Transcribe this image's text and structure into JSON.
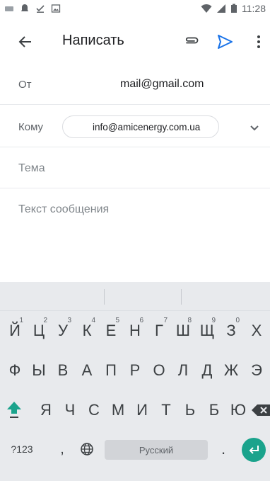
{
  "status_bar": {
    "time": "11:28"
  },
  "app_bar": {
    "title": "Написать"
  },
  "from": {
    "label": "От",
    "value": "mail@gmail.com"
  },
  "to": {
    "label": "Кому",
    "chip": "info@amicenergy.com.ua"
  },
  "subject": {
    "placeholder": "Тема"
  },
  "body": {
    "placeholder": "Текст сообщения"
  },
  "keyboard": {
    "row1": [
      {
        "char": "Й",
        "hint": "1"
      },
      {
        "char": "Ц",
        "hint": "2"
      },
      {
        "char": "У",
        "hint": "3"
      },
      {
        "char": "К",
        "hint": "4"
      },
      {
        "char": "Е",
        "hint": "5"
      },
      {
        "char": "Н",
        "hint": "6"
      },
      {
        "char": "Г",
        "hint": "7"
      },
      {
        "char": "Ш",
        "hint": "8"
      },
      {
        "char": "Щ",
        "hint": "9"
      },
      {
        "char": "З",
        "hint": "0"
      },
      {
        "char": "Х",
        "hint": ""
      }
    ],
    "row2": [
      "Ф",
      "Ы",
      "В",
      "А",
      "П",
      "Р",
      "О",
      "Л",
      "Д",
      "Ж",
      "Э"
    ],
    "row3": [
      "Я",
      "Ч",
      "С",
      "М",
      "И",
      "Т",
      "Ь",
      "Б",
      "Ю"
    ],
    "num_key": "?123",
    "comma_key": ",",
    "space_key": "Русский",
    "dot_key": "."
  },
  "colors": {
    "accent": "#1a73e8",
    "keyboard_accent": "#1aa38c",
    "keyboard_bg": "#e8eaed"
  }
}
